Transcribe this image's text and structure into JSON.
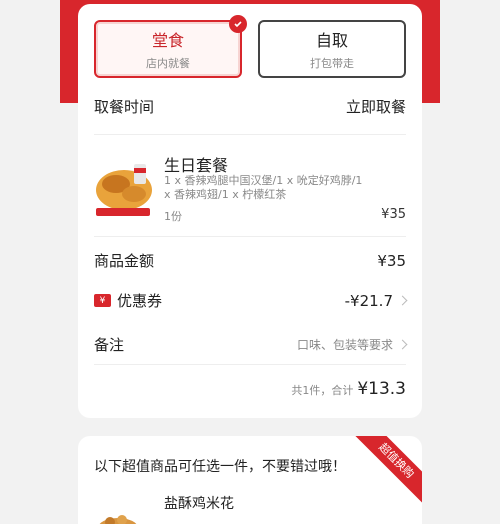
{
  "modes": [
    {
      "title": "堂食",
      "sub": "店内就餐",
      "active": true
    },
    {
      "title": "自取",
      "sub": "打包带走",
      "active": false
    }
  ],
  "pickup": {
    "label": "取餐时间",
    "value": "立即取餐"
  },
  "item": {
    "name": "生日套餐",
    "desc": "1 x 香辣鸡腿中国汉堡/1 x 吮定好鸡脖/1 x 香辣鸡翅/1 x 柠檬红茶",
    "qty": "1份",
    "price": "¥35"
  },
  "subtotal": {
    "label": "商品金额",
    "value": "¥35"
  },
  "coupon": {
    "label": "优惠券",
    "value": "-¥21.7",
    "icon_glyph": "¥"
  },
  "note": {
    "label": "备注",
    "placeholder": "口味、包装等要求"
  },
  "total": {
    "label": "共1件，合计",
    "value": "¥13.3"
  },
  "promo": {
    "title": "以下超值商品可任选一件，不要错过哦！",
    "ribbon": "超值换购",
    "item_name": "盐酥鸡米花"
  },
  "colors": {
    "accent": "#d8262c"
  }
}
